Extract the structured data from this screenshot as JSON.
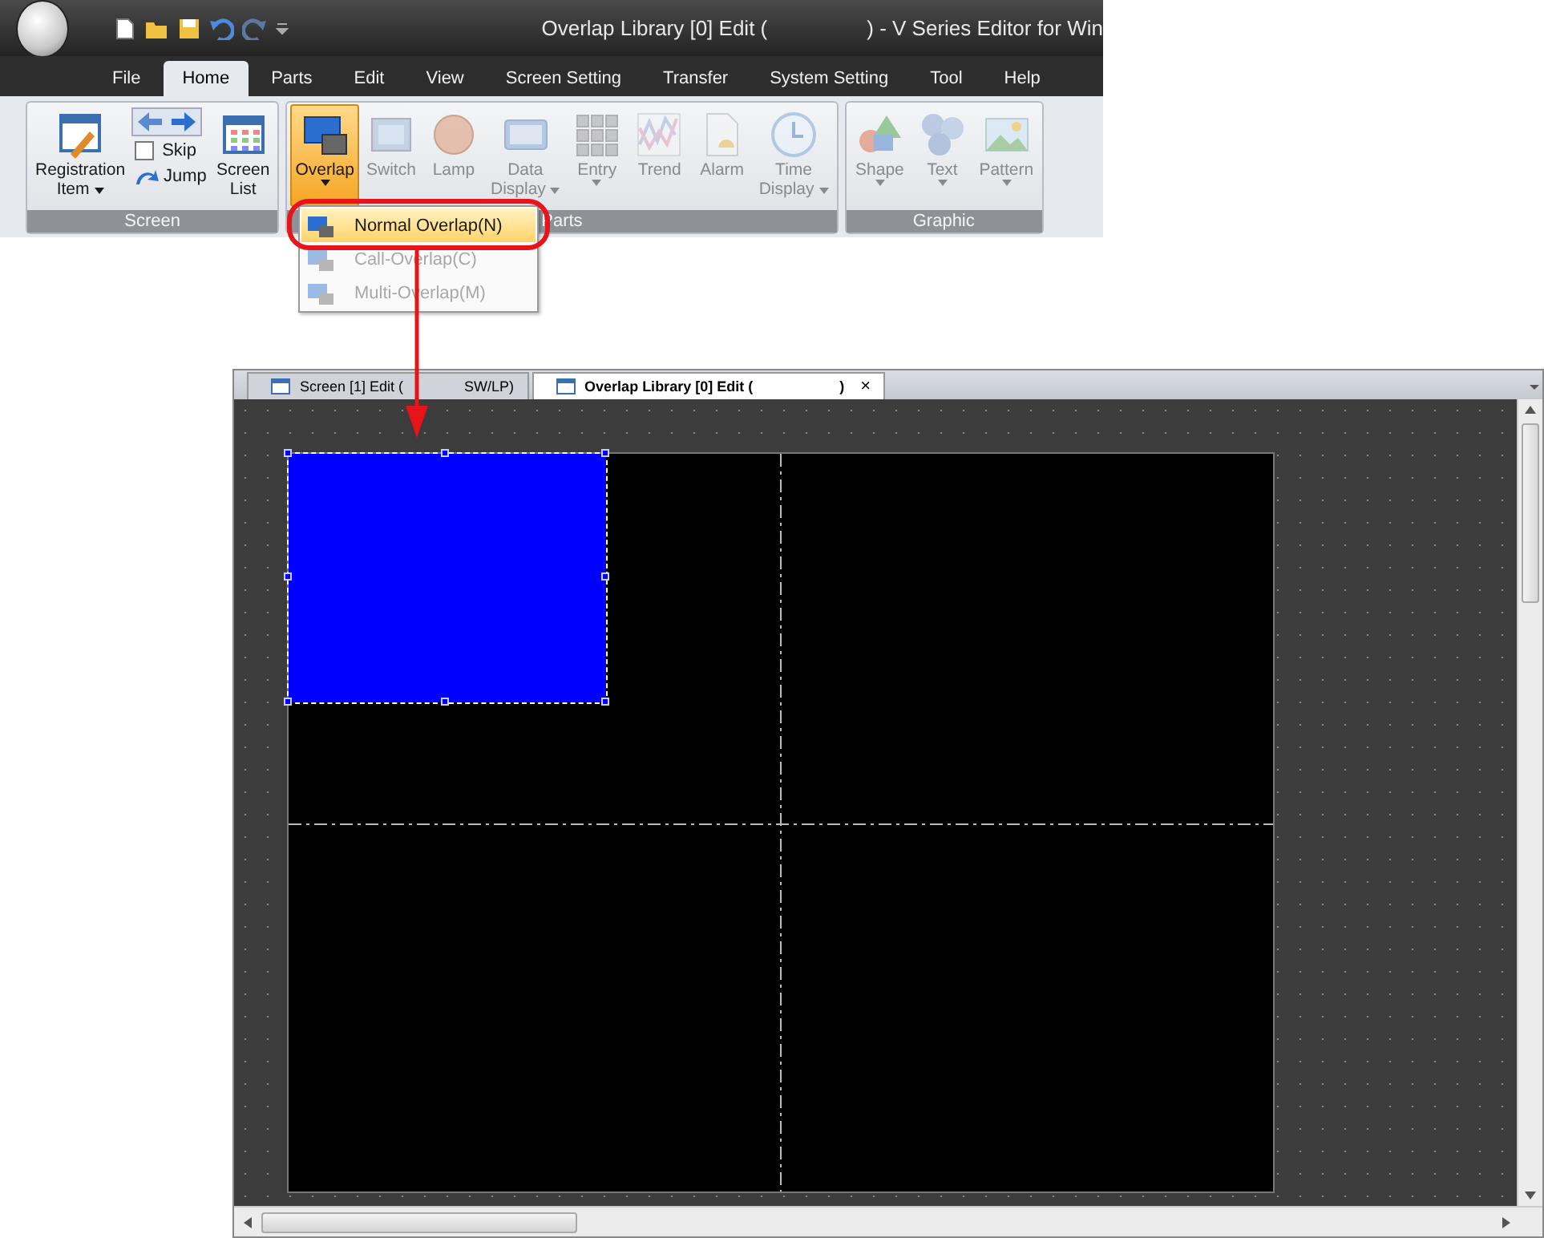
{
  "window": {
    "title_start": "Overlap Library [0] Edit (",
    "title_end": ") - V Series Editor for Win"
  },
  "tabs": [
    {
      "label": "File",
      "selected": false
    },
    {
      "label": "Home",
      "selected": true
    },
    {
      "label": "Parts",
      "selected": false
    },
    {
      "label": "Edit",
      "selected": false
    },
    {
      "label": "View",
      "selected": false
    },
    {
      "label": "Screen Setting",
      "selected": false
    },
    {
      "label": "Transfer",
      "selected": false
    },
    {
      "label": "System Setting",
      "selected": false
    },
    {
      "label": "Tool",
      "selected": false
    },
    {
      "label": "Help",
      "selected": false
    }
  ],
  "groups": [
    {
      "label": "Screen",
      "items": [
        {
          "kind": "large",
          "label": "Registration",
          "label2": "Item",
          "dropdown": true,
          "disabled": false,
          "active": false
        },
        {
          "kind": "stack",
          "parts": [
            {
              "kind": "arrows"
            },
            {
              "kind": "checkbox",
              "label": "Skip",
              "checked": false
            },
            {
              "kind": "small",
              "label": "Jump"
            }
          ]
        },
        {
          "kind": "large",
          "label": "Screen",
          "label2": "List",
          "dropdown": false,
          "disabled": false,
          "active": false
        }
      ]
    },
    {
      "label": "Parts",
      "items": [
        {
          "kind": "large",
          "label": "Overlap",
          "dropdown": true,
          "disabled": false,
          "active": true
        },
        {
          "kind": "large",
          "label": "Switch",
          "dropdown": false,
          "disabled": true,
          "active": false
        },
        {
          "kind": "large",
          "label": "Lamp",
          "dropdown": false,
          "disabled": true,
          "active": false
        },
        {
          "kind": "large",
          "label": "Data",
          "label2": "Display",
          "dropdown": true,
          "disabled": true,
          "active": false
        },
        {
          "kind": "large",
          "label": "Entry",
          "dropdown": true,
          "disabled": true,
          "active": false
        },
        {
          "kind": "large",
          "label": "Trend",
          "dropdown": false,
          "disabled": true,
          "active": false
        },
        {
          "kind": "large",
          "label": "Alarm",
          "dropdown": false,
          "disabled": true,
          "active": false
        },
        {
          "kind": "large",
          "label": "Time",
          "label2": "Display",
          "dropdown": true,
          "disabled": true,
          "active": false
        }
      ]
    },
    {
      "label": "Graphic",
      "items": [
        {
          "kind": "large",
          "label": "Shape",
          "dropdown": true,
          "disabled": true,
          "active": false
        },
        {
          "kind": "large",
          "label": "Text",
          "dropdown": true,
          "disabled": true,
          "active": false
        },
        {
          "kind": "large",
          "label": "Pattern",
          "dropdown": true,
          "disabled": true,
          "active": false
        }
      ]
    }
  ],
  "menu": [
    {
      "label": "Normal Overlap(N)",
      "disabled": false,
      "selected": true
    },
    {
      "label": "Call-Overlap(C)",
      "disabled": true,
      "selected": false
    },
    {
      "label": "Multi-Overlap(M)",
      "disabled": true,
      "selected": false
    }
  ],
  "editor_tabs": [
    {
      "label_start": "Screen [1] Edit (",
      "label_end": "SW/LP)",
      "selected": false,
      "closable": false
    },
    {
      "label_start": "Overlap Library [0] Edit (",
      "label_end": ")",
      "selected": true,
      "closable": true,
      "close": "×"
    }
  ]
}
